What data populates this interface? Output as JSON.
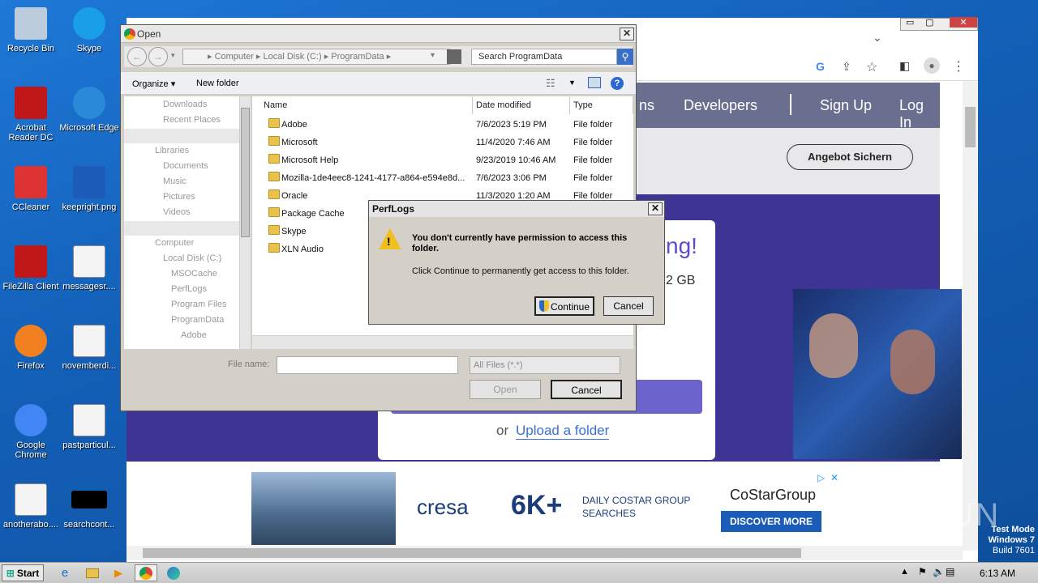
{
  "desktop": {
    "icons": [
      {
        "label": "Recycle Bin",
        "icon": "recycle-bin-icon"
      },
      {
        "label": "Skype",
        "icon": "skype-icon"
      },
      {
        "label": "Acrobat Reader DC",
        "icon": "acrobat-icon"
      },
      {
        "label": "Microsoft Edge",
        "icon": "edge-icon"
      },
      {
        "label": "CCleaner",
        "icon": "ccleaner-icon"
      },
      {
        "label": "keepright.png",
        "icon": "image-file-icon"
      },
      {
        "label": "FileZilla Client",
        "icon": "filezilla-icon"
      },
      {
        "label": "messagesr....",
        "icon": "word-doc-icon"
      },
      {
        "label": "Firefox",
        "icon": "firefox-icon"
      },
      {
        "label": "novemberdi...",
        "icon": "word-doc-icon"
      },
      {
        "label": "Google Chrome",
        "icon": "chrome-icon"
      },
      {
        "label": "pastparticul...",
        "icon": "word-doc-icon"
      },
      {
        "label": "anotherabo....",
        "icon": "word-doc-icon"
      },
      {
        "label": "searchcont...",
        "icon": "black-file-icon"
      }
    ]
  },
  "site": {
    "nav": [
      "ns",
      "Developers",
      "Sign Up",
      "Log In"
    ],
    "cta": "Angebot Sichern",
    "hero_partial": "ng!",
    "size_partial": "2 GB",
    "upload_or": "or",
    "upload_link": "Upload a folder"
  },
  "ad": {
    "brand": "cresa",
    "big": "6K+",
    "line1": "DAILY COSTAR GROUP",
    "line2": "SEARCHES",
    "costar": "CoStarGroup",
    "button": "DISCOVER MORE"
  },
  "watermark": {
    "text": "ANY RUN",
    "mode": "Test Mode",
    "os": "Windows 7",
    "build": "Build 7601"
  },
  "taskbar": {
    "start": "Start",
    "time": "6:13 AM"
  },
  "open_dialog": {
    "title": "Open",
    "address": "▸ Computer ▸ Local Disk (C:) ▸ ProgramData ▸",
    "search_placeholder": "Search ProgramData",
    "organize": "Organize ▾",
    "new_folder": "New folder",
    "nav": [
      "Downloads",
      "Recent Places",
      "Libraries",
      "Documents",
      "Music",
      "Pictures",
      "Videos",
      "Computer",
      "Local Disk (C:)",
      "MSOCache",
      "PerfLogs",
      "Program Files",
      "ProgramData",
      "Adobe"
    ],
    "columns": [
      "Name",
      "Date modified",
      "Type"
    ],
    "rows": [
      {
        "name": "Adobe",
        "date": "7/6/2023 5:19 PM",
        "type": "File folder"
      },
      {
        "name": "Microsoft",
        "date": "11/4/2020 7:46 AM",
        "type": "File folder"
      },
      {
        "name": "Microsoft Help",
        "date": "9/23/2019 10:46 AM",
        "type": "File folder"
      },
      {
        "name": "Mozilla-1de4eec8-1241-4177-a864-e594e8d...",
        "date": "7/6/2023 3:06 PM",
        "type": "File folder"
      },
      {
        "name": "Oracle",
        "date": "11/3/2020 1:20 AM",
        "type": "File folder"
      },
      {
        "name": "Package Cache",
        "date": "",
        "type": ""
      },
      {
        "name": "Skype",
        "date": "",
        "type": ""
      },
      {
        "name": "XLN Audio",
        "date": "",
        "type": ""
      }
    ],
    "filename_label": "File name:",
    "filename_value": "",
    "filter": "All Files (*.*)",
    "open": "Open",
    "cancel": "Cancel"
  },
  "perm_dialog": {
    "title": "PerfLogs",
    "heading": "You don't currently have permission to access this folder.",
    "body": "Click Continue to permanently get access to this folder.",
    "continue": "Continue",
    "cancel": "Cancel"
  }
}
